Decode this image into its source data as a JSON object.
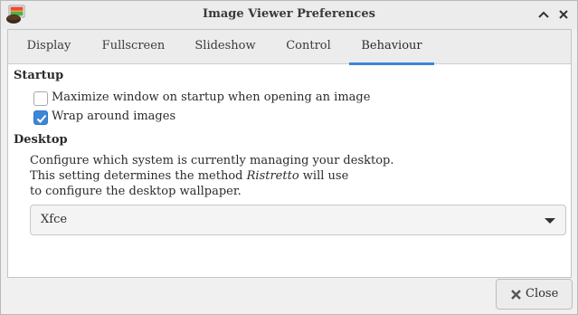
{
  "window": {
    "title": "Image Viewer Preferences",
    "app_icon": "ristretto-icon"
  },
  "tabs": [
    {
      "label": "Display",
      "active": false
    },
    {
      "label": "Fullscreen",
      "active": false
    },
    {
      "label": "Slideshow",
      "active": false
    },
    {
      "label": "Control",
      "active": false
    },
    {
      "label": "Behaviour",
      "active": true
    }
  ],
  "startup": {
    "title": "Startup",
    "options": [
      {
        "label": "Maximize window on startup when opening an image",
        "checked": false
      },
      {
        "label": "Wrap around images",
        "checked": true
      }
    ]
  },
  "desktop": {
    "title": "Desktop",
    "description": {
      "line1": "Configure which system is currently managing your desktop.",
      "line2_before": "This setting determines the method ",
      "line2_app": "Ristretto",
      "line2_after": " will use",
      "line3": "to configure the desktop wallpaper."
    },
    "selected_option": "Xfce"
  },
  "footer": {
    "close_label": "Close"
  },
  "colors": {
    "accent": "#3c86d8",
    "background": "#f0f0f0"
  }
}
